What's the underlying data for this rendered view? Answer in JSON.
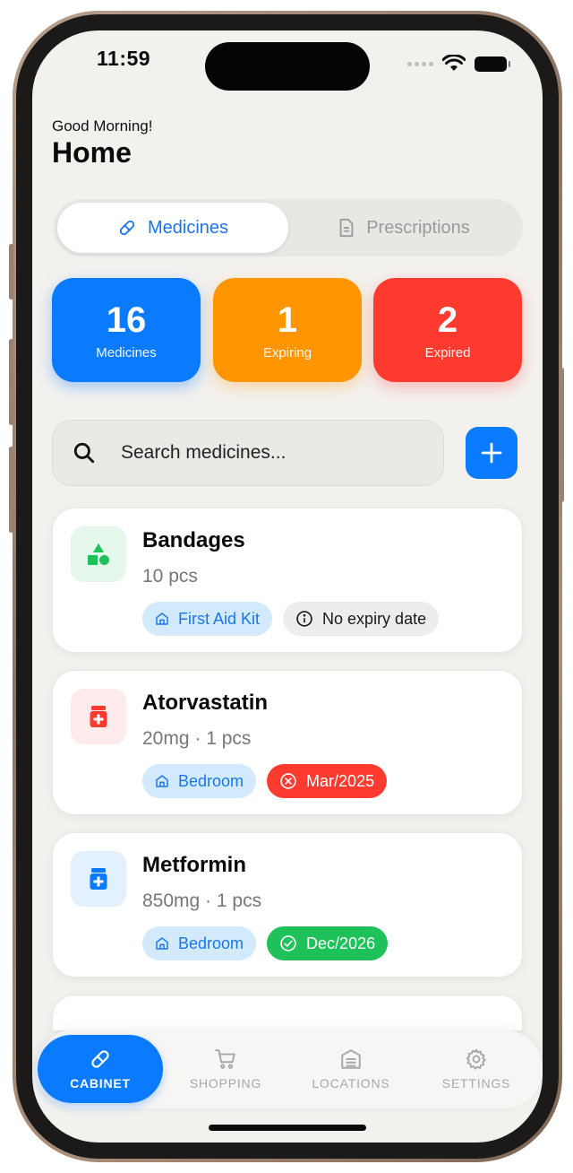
{
  "status_bar": {
    "time": "11:59"
  },
  "header": {
    "greeting": "Good Morning!",
    "title": "Home"
  },
  "segments": [
    {
      "label": "Medicines",
      "icon": "pill-icon",
      "selected": true
    },
    {
      "label": "Prescriptions",
      "icon": "document-icon",
      "selected": false
    }
  ],
  "stats": [
    {
      "value": "16",
      "label": "Medicines",
      "color": "#0a7aff"
    },
    {
      "value": "1",
      "label": "Expiring",
      "color": "#ff9500"
    },
    {
      "value": "2",
      "label": "Expired",
      "color": "#ff3b30"
    }
  ],
  "search": {
    "placeholder": "Search medicines..."
  },
  "medicines": [
    {
      "name": "Bandages",
      "detail": "10 pcs",
      "icon": "shapes-icon",
      "location": "First Aid Kit",
      "expiry": "No expiry date",
      "expiry_status": "none"
    },
    {
      "name": "Atorvastatin",
      "detail": "20mg · 1 pcs",
      "icon": "medicine-bottle-icon",
      "location": "Bedroom",
      "expiry": "Mar/2025",
      "expiry_status": "expired"
    },
    {
      "name": "Metformin",
      "detail": "850mg · 1 pcs",
      "icon": "medicine-bottle-icon",
      "location": "Bedroom",
      "expiry": "Dec/2026",
      "expiry_status": "valid"
    }
  ],
  "tabbar": [
    {
      "label": "CABINET",
      "icon": "pill-icon",
      "active": true
    },
    {
      "label": "SHOPPING",
      "icon": "cart-icon",
      "active": false
    },
    {
      "label": "LOCATIONS",
      "icon": "archive-icon",
      "active": false
    },
    {
      "label": "SETTINGS",
      "icon": "gear-icon",
      "active": false
    }
  ]
}
